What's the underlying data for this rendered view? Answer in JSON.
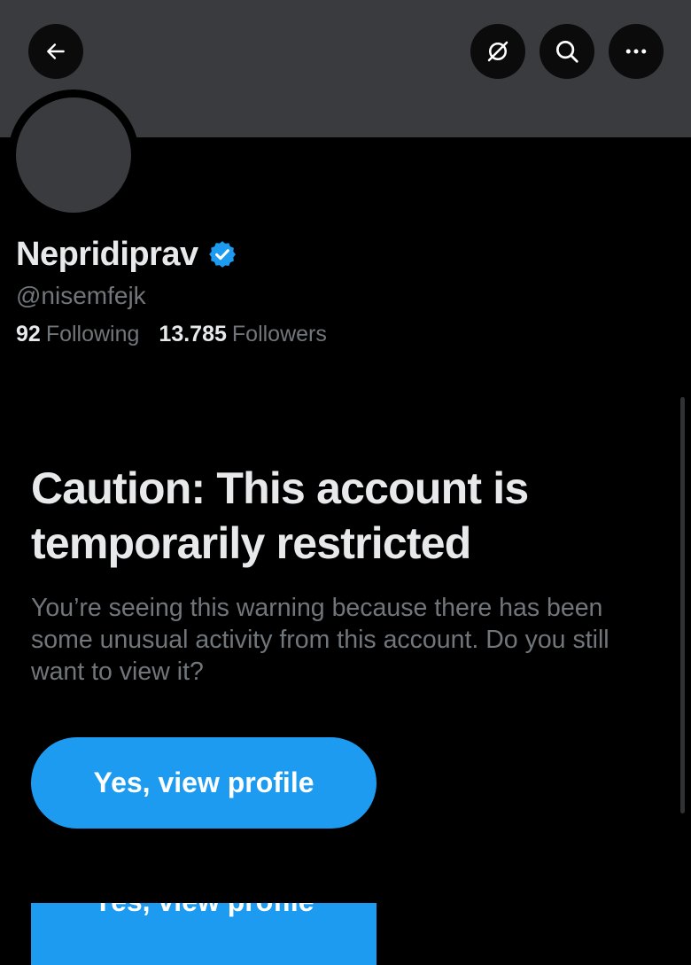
{
  "header": {
    "back_icon": "arrow-left-icon",
    "translate_icon": "translate-off-icon",
    "search_icon": "search-icon",
    "more_icon": "more-horizontal-icon",
    "banner_color": "#3a3b3e"
  },
  "profile": {
    "display_name": "Nepridiprav",
    "verified_icon": "verified-badge-icon",
    "verified_color": "#1d9bf0",
    "handle": "@nisemfejk",
    "following_count": "92",
    "following_label": "Following",
    "followers_count": "13.785",
    "followers_label": "Followers"
  },
  "warning": {
    "title": "Caution: This account is temporarily restricted",
    "body": "You’re seeing this warning because there has been some unusual activity from this account. Do you still want to view it?",
    "button_label": "Yes, view profile",
    "button_color": "#1d9bf0",
    "ghost_button_label": "Yes, view profile"
  }
}
